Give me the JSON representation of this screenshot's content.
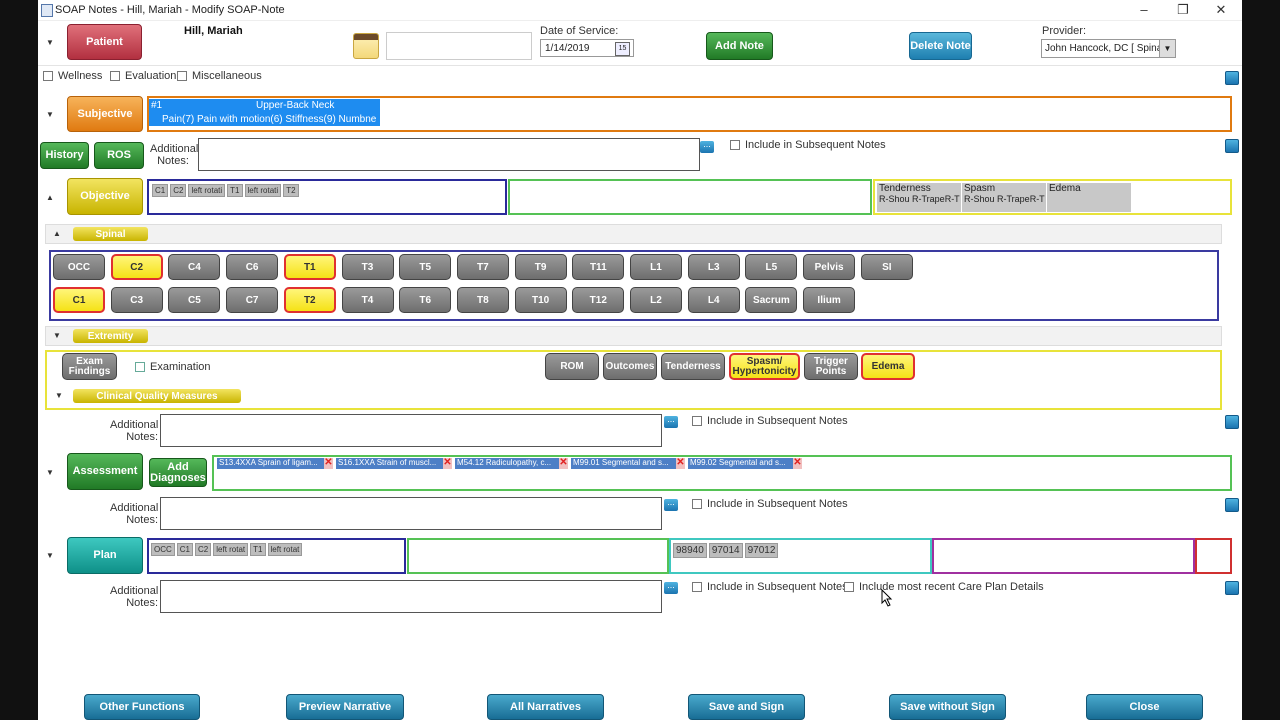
{
  "window": {
    "title": "SOAP Notes - Hill, Mariah - Modify SOAP-Note"
  },
  "header": {
    "patient_label": "Patient",
    "patient_name": "Hill, Mariah",
    "date_label": "Date of Service:",
    "date_value": "1/14/2019",
    "add_note": "Add Note",
    "delete_note": "Delete Note",
    "provider_label": "Provider:",
    "provider_value": "John Hancock, DC [ Spinal"
  },
  "filters": [
    "Wellness",
    "Evaluation",
    "Miscellaneous"
  ],
  "subjective": {
    "label": "Subjective",
    "complaint": {
      "number": "#1",
      "title": "Upper-Back Neck",
      "detail": "Pain(7) Pain with motion(6) Stiffness(9) Numbne"
    },
    "history": "History",
    "ros": "ROS",
    "notes_label": "Additional Notes:",
    "include": "Include in Subsequent Notes"
  },
  "objective": {
    "label": "Objective",
    "tags": [
      "C1",
      "C2",
      "left rotati",
      "T1",
      "left rotati",
      "T2"
    ],
    "findings": [
      {
        "title": "Tenderness",
        "value": "R-Shou R-TrapeR-T"
      },
      {
        "title": "Spasm",
        "value": "R-Shou R-TrapeR-T"
      },
      {
        "title": "Edema",
        "value": ""
      }
    ]
  },
  "spinal": {
    "label": "Spinal",
    "row1": [
      "OCC",
      "C2",
      "C4",
      "C6",
      "T1",
      "T3",
      "T5",
      "T7",
      "T9",
      "T11",
      "L1",
      "L3",
      "L5",
      "Pelvis",
      "SI"
    ],
    "row2": [
      "C1",
      "C3",
      "C5",
      "C7",
      "T2",
      "T4",
      "T6",
      "T8",
      "T10",
      "T12",
      "L2",
      "L4",
      "Sacrum",
      "Ilium"
    ],
    "highlighted": [
      "C2",
      "T1",
      "C1",
      "T2"
    ]
  },
  "extremity": {
    "label": "Extremity",
    "exam_findings": "Exam Findings",
    "examination": "Examination",
    "buttons": [
      "ROM",
      "Outcomes",
      "Tenderness",
      "Spasm/ Hypertonicity",
      "Trigger Points",
      "Edema"
    ]
  },
  "cqm": {
    "label": "Clinical Quality Measures"
  },
  "objective_notes": {
    "label": "Additional Notes:",
    "include": "Include in Subsequent Notes"
  },
  "assessment": {
    "label": "Assessment",
    "add_dx": "Add Diagnoses",
    "diagnoses": [
      "S13.4XXA Sprain of ligam...",
      "S16.1XXA Strain of muscl...",
      "M54.12 Radiculopathy, c...",
      "M99.01 Segmental and s...",
      "M99.02 Segmental and s..."
    ],
    "notes_label": "Additional Notes:",
    "include": "Include in Subsequent Notes"
  },
  "plan": {
    "label": "Plan",
    "tags": [
      "OCC",
      "C1",
      "C2",
      "left rotat",
      "T1",
      "left rotat"
    ],
    "codes": [
      "98940",
      "97014",
      "97012"
    ],
    "notes_label": "Additional Notes:",
    "include": "Include in Subsequent Notes",
    "include_care": "Include most recent Care Plan Details"
  },
  "footer": [
    "Other Functions",
    "Preview Narrative",
    "All Narratives",
    "Save and Sign",
    "Save without Sign",
    "Close"
  ],
  "colors": {
    "accent_blue": "#1e7fb0",
    "subjective_border": "#e07a10",
    "objective_border": "#2a2a9a",
    "assessment_border": "#55c255"
  }
}
